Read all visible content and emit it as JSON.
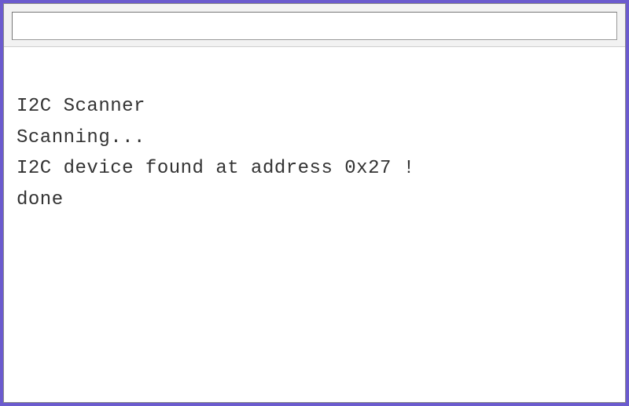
{
  "input": {
    "value": "",
    "placeholder": ""
  },
  "console": {
    "lines": [
      "",
      "I2C Scanner",
      "Scanning...",
      "I2C device found at address 0x27 !",
      "done"
    ]
  }
}
